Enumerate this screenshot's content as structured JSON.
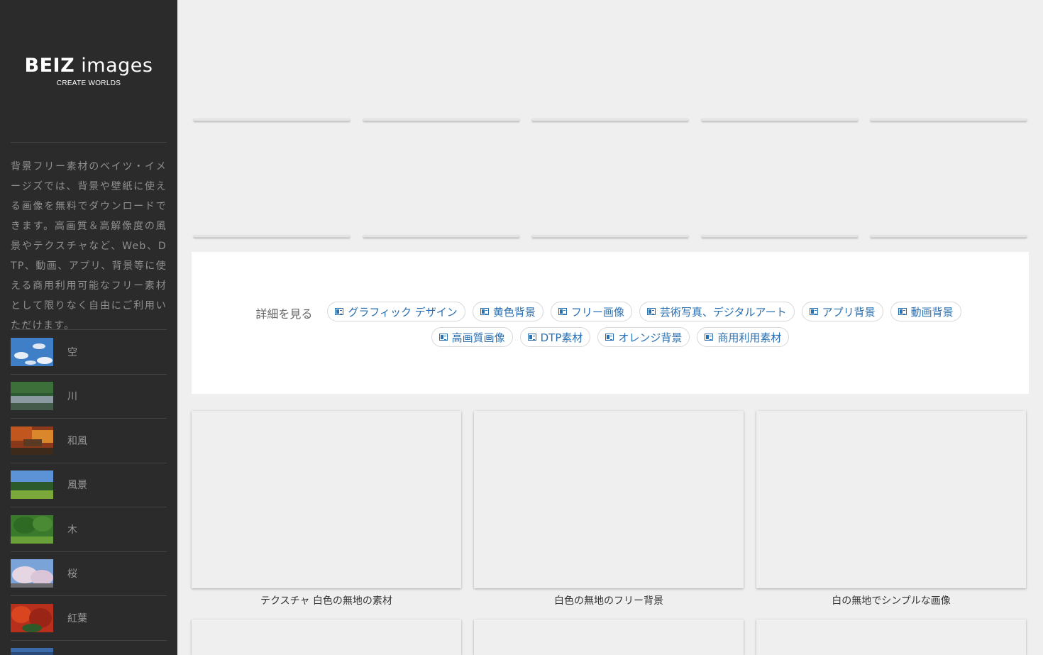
{
  "brand": {
    "name_bold": "BEIZ",
    "name_light": "images",
    "tagline": "CREATE WORLDS"
  },
  "sidebar": {
    "description": "背景フリー素材のベイツ・イメージズでは、背景や壁紙に使える画像を無料でダウンロードできます。高画質＆高解像度の風景やテクスチャなど、Web、DTP、動画、アプリ、背景等に使える商用利用可能なフリー素材として限りなく自由にご利用いただけます。",
    "categories": [
      {
        "label": "空"
      },
      {
        "label": "川"
      },
      {
        "label": "和風"
      },
      {
        "label": "風景"
      },
      {
        "label": "木"
      },
      {
        "label": "桜"
      },
      {
        "label": "紅葉"
      },
      {
        "label": ""
      }
    ]
  },
  "tags": {
    "details_label": "詳細を見る",
    "row1": [
      "グラフィック デザイン",
      "黄色背景",
      "フリー画像",
      "芸術写真、デジタルアート",
      "アプリ背景",
      "動画背景"
    ],
    "row2": [
      "高画質画像",
      "DTP素材",
      "オレンジ背景",
      "商用利用素材"
    ]
  },
  "images": [
    {
      "caption": "テクスチャ 白色の無地の素材"
    },
    {
      "caption": "白色の無地のフリー背景"
    },
    {
      "caption": "白の無地でシンプルな画像"
    }
  ]
}
